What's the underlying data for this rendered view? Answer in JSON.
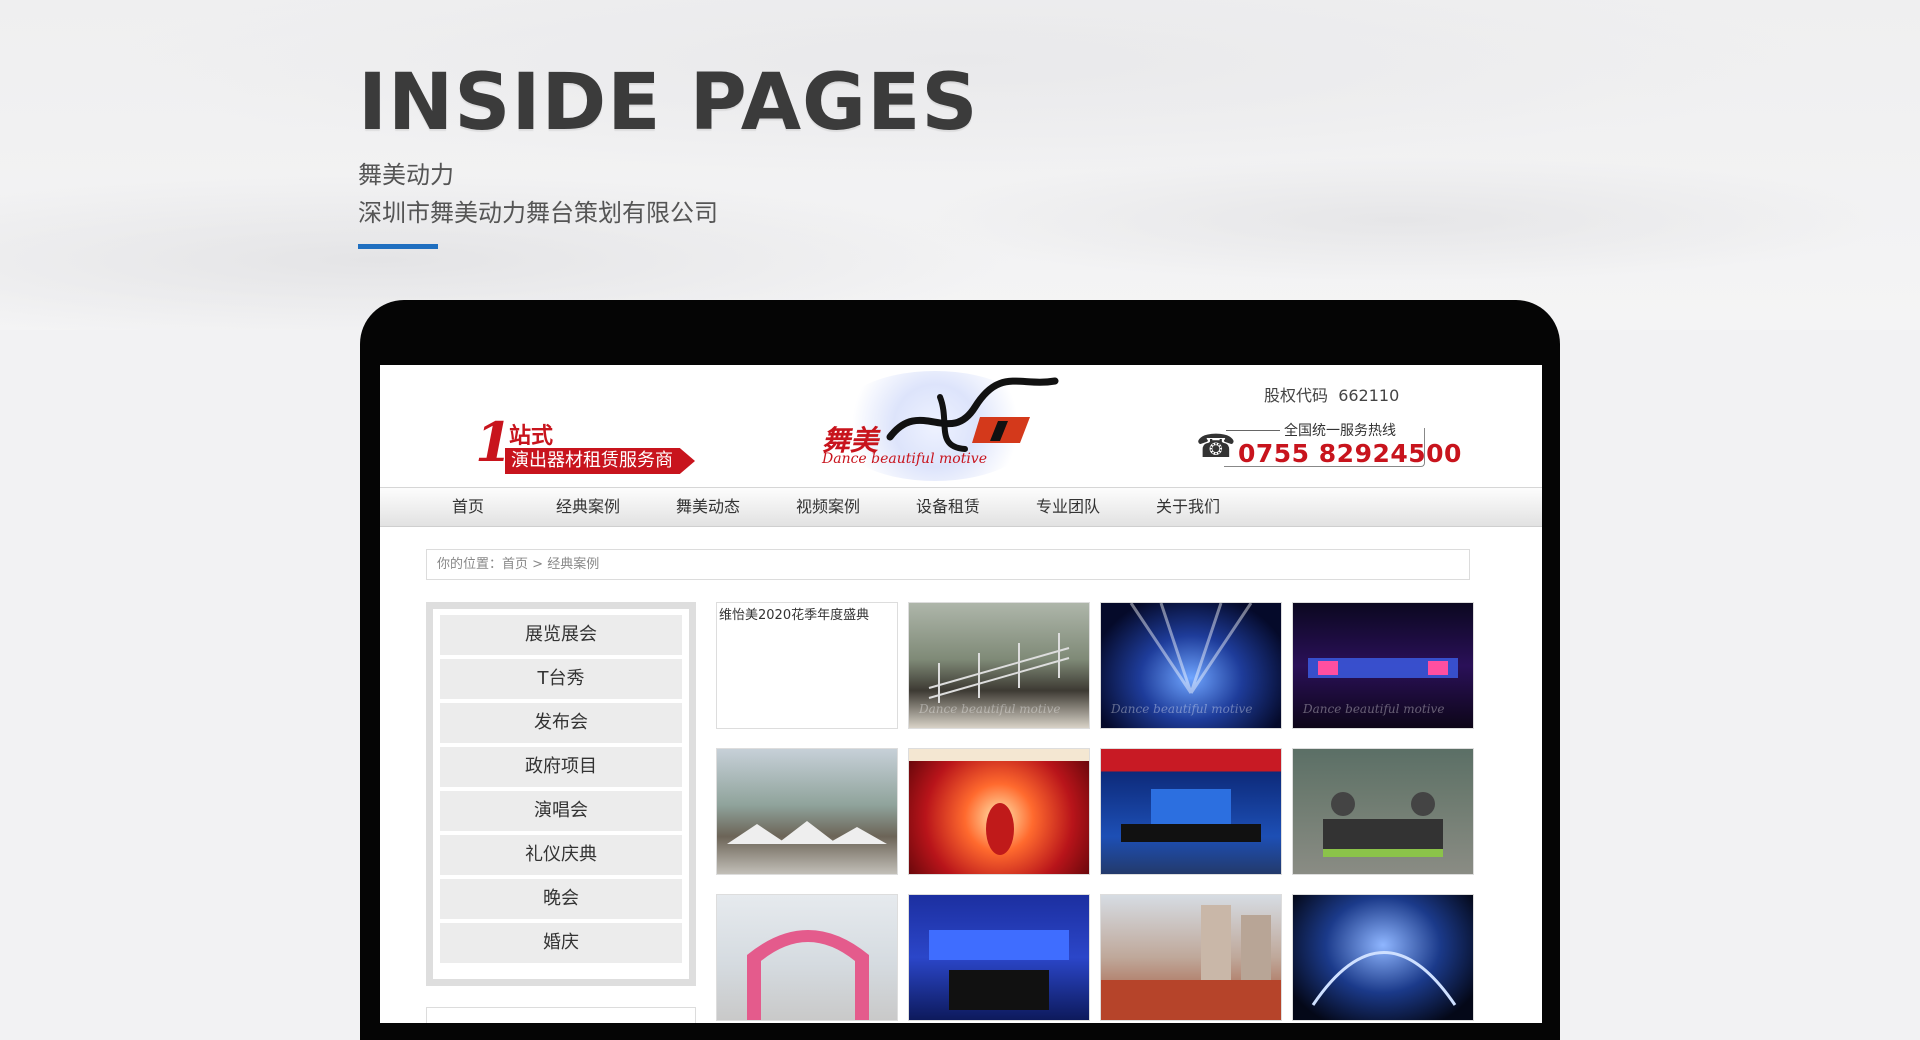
{
  "hero": {
    "title": "INSIDE PAGES",
    "subtitle1": "舞美动力",
    "subtitle2": "深圳市舞美动力舞台策划有限公司"
  },
  "header": {
    "slogan_num": "1",
    "slogan_top": "站式",
    "slogan_bottom": "演出器材租赁服务商",
    "logo_cn": "舞美",
    "logo_en": "Dance beautiful motive",
    "stock_label": "股权代码",
    "stock_code": "662110",
    "hotline_label": "全国统一服务热线",
    "hotline_number": "0755 82924500"
  },
  "nav": [
    "首页",
    "经典案例",
    "舞美动态",
    "视频案例",
    "设备租赁",
    "专业团队",
    "关于我们"
  ],
  "breadcrumb": {
    "prefix": "你的位置：",
    "home": "首页",
    "sep": ">",
    "current": "经典案例"
  },
  "sidebar": [
    "展览展会",
    "T台秀",
    "发布会",
    "政府项目",
    "演唱会",
    "礼仪庆典",
    "晚会",
    "婚庆"
  ],
  "gallery": {
    "broken_alt": "维怡美2020花季年度盛典",
    "watermark": "Dance beautiful motive"
  },
  "colors": {
    "accent_blue": "#1f6fc0",
    "brand_red": "#c8141d"
  }
}
